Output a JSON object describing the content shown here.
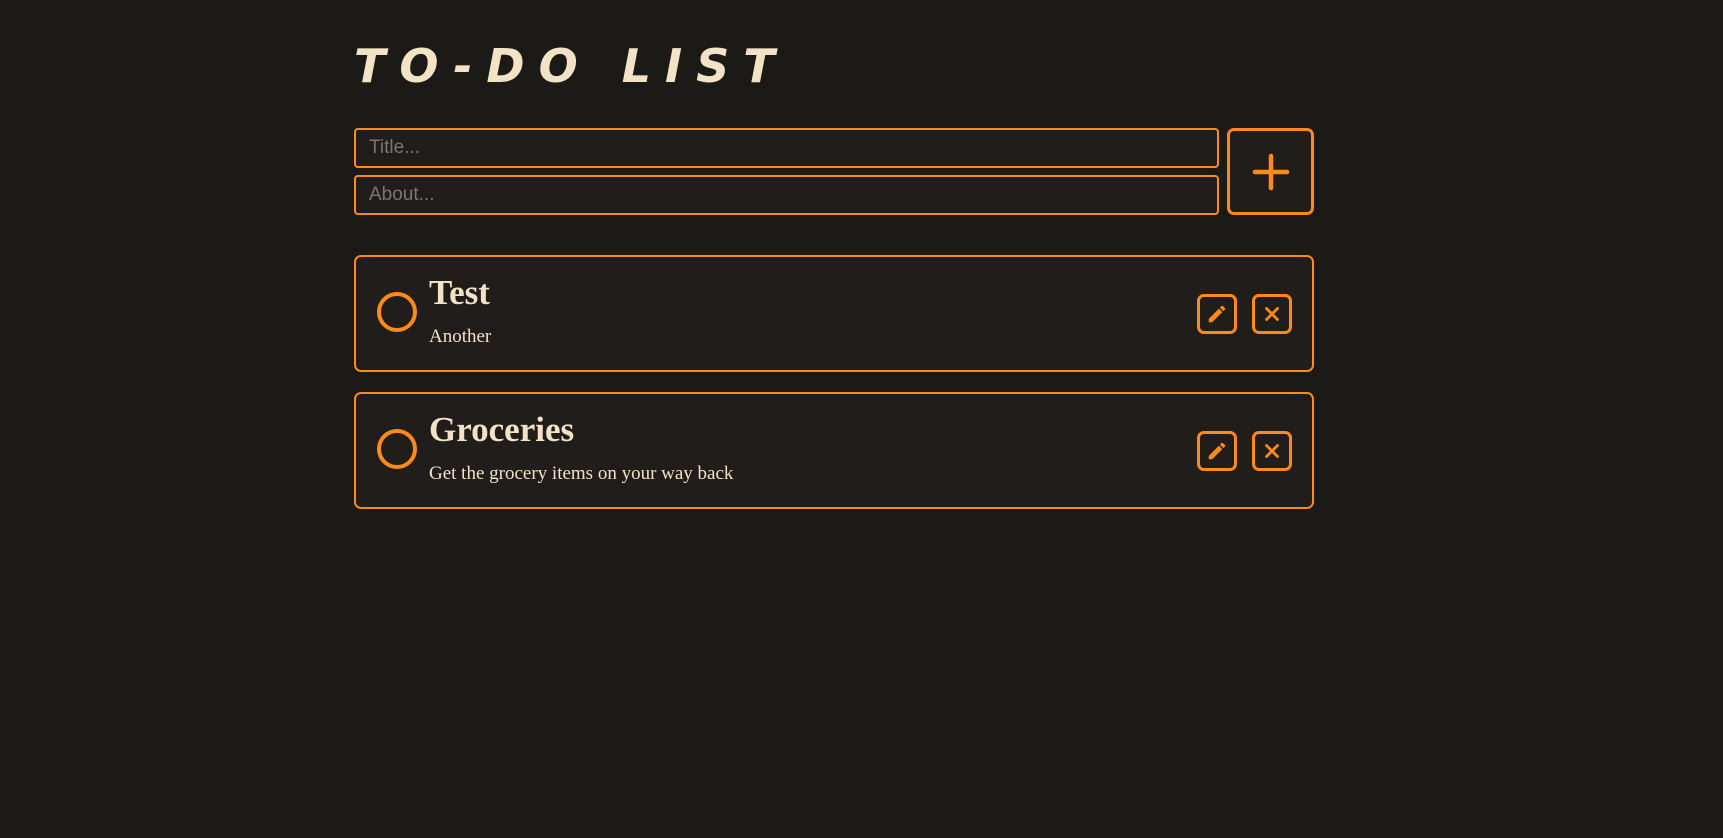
{
  "app": {
    "title": "TO-DO LIST"
  },
  "form": {
    "title_placeholder": "Title...",
    "title_value": "",
    "about_placeholder": "About...",
    "about_value": "",
    "add_icon": "plus-icon"
  },
  "tasks": [
    {
      "title": "Test",
      "description": "Another",
      "completed": false,
      "edit_icon": "pencil-icon",
      "delete_icon": "close-icon"
    },
    {
      "title": "Groceries",
      "description": "Get the grocery items on your way back",
      "completed": false,
      "edit_icon": "pencil-icon",
      "delete_icon": "close-icon"
    }
  ],
  "colors": {
    "background": "#1c1a17",
    "surface": "#201d1a",
    "accent": "#ff8a1c",
    "text": "#f2e3c6",
    "placeholder": "#7d766e"
  }
}
